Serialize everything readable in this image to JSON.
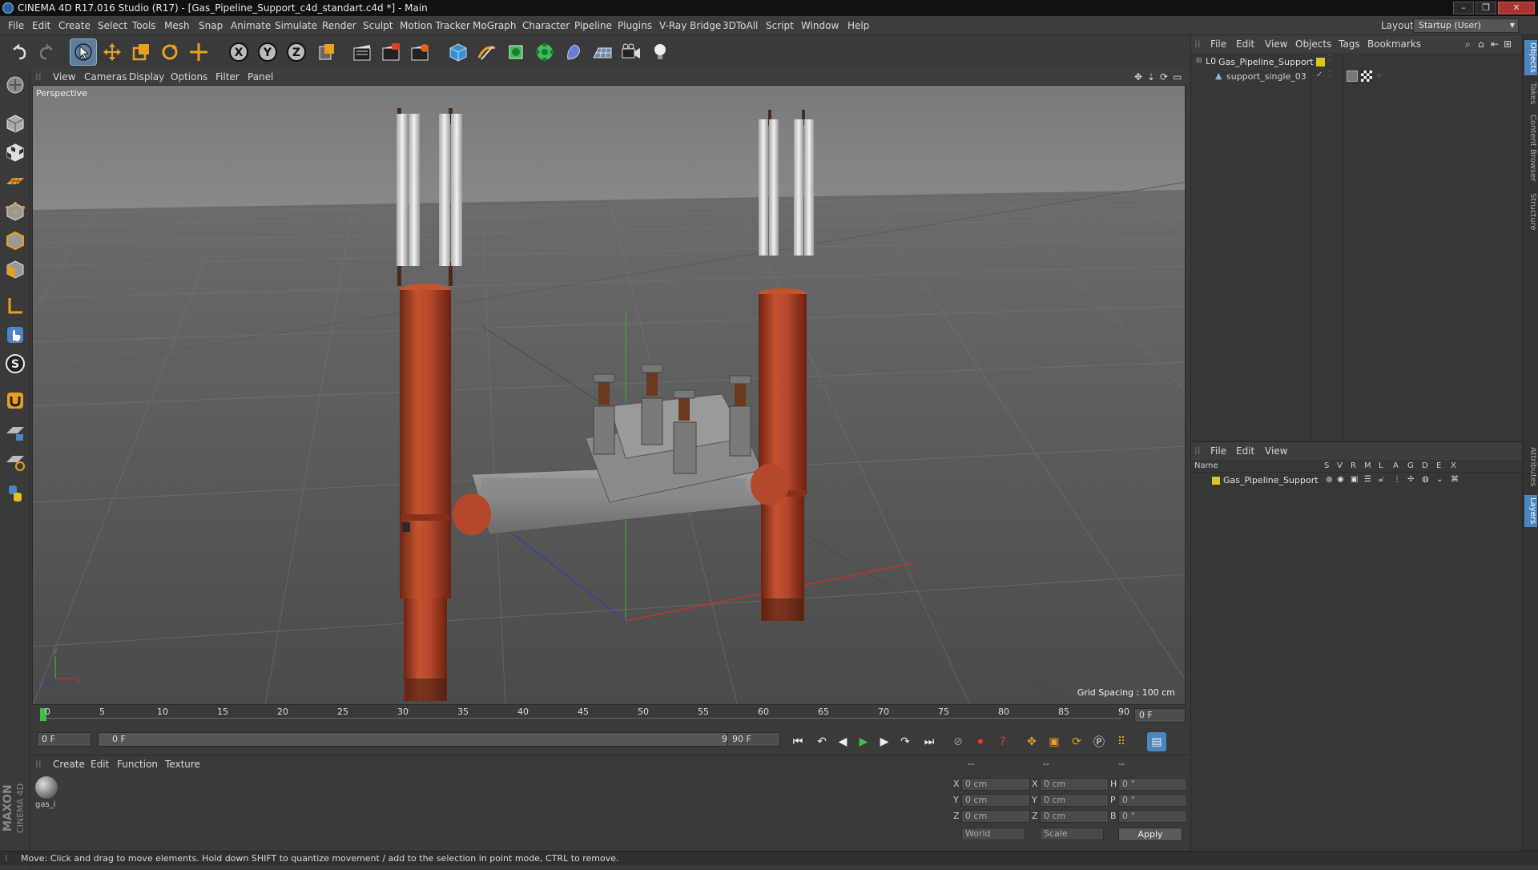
{
  "window": {
    "title": "CINEMA 4D R17.016 Studio (R17) - [Gas_Pipeline_Support_c4d_standart.c4d *] - Main",
    "controls": {
      "minimize": "–",
      "maximize": "❐",
      "close": "✕"
    }
  },
  "menubar": {
    "items": [
      "File",
      "Edit",
      "Create",
      "Select",
      "Tools",
      "Mesh",
      "Snap",
      "Animate",
      "Simulate",
      "Render",
      "Sculpt",
      "Motion Tracker",
      "MoGraph",
      "Character",
      "Pipeline",
      "Plugins",
      "V-Ray Bridge",
      "3DToAll",
      "Script",
      "Window",
      "Help"
    ],
    "layout_label": "Layout:",
    "layout_value": "Startup (User)"
  },
  "toolbar": {
    "axis_labels": [
      "X",
      "Y",
      "Z"
    ]
  },
  "viewport": {
    "menu": [
      "View",
      "Cameras",
      "Display",
      "Options",
      "Filter",
      "Panel"
    ],
    "label": "Perspective",
    "grid_spacing": "Grid Spacing : 100 cm",
    "axis_gizmo": {
      "x": "x",
      "y": "y",
      "z": "z"
    }
  },
  "timeline": {
    "ticks": [
      "0",
      "5",
      "10",
      "15",
      "20",
      "25",
      "30",
      "35",
      "40",
      "45",
      "50",
      "55",
      "60",
      "65",
      "70",
      "75",
      "80",
      "85",
      "90"
    ],
    "current_frame_right": "0 F"
  },
  "transport": {
    "start_field": "0 F",
    "range_start": "0 F",
    "range_end": "90 F",
    "end_field": "90 F"
  },
  "material_manager": {
    "menu": [
      "Create",
      "Edit",
      "Function",
      "Texture"
    ],
    "material_name": "gas_i"
  },
  "coordinates": {
    "headers": [
      "--",
      "--",
      "--"
    ],
    "rows": [
      {
        "l1": "X",
        "v1": "0 cm",
        "l2": "X",
        "v2": "0 cm",
        "l3": "H",
        "v3": "0 °"
      },
      {
        "l1": "Y",
        "v1": "0 cm",
        "l2": "Y",
        "v2": "0 cm",
        "l3": "P",
        "v3": "0 °"
      },
      {
        "l1": "Z",
        "v1": "0 cm",
        "l2": "Z",
        "v2": "0 cm",
        "l3": "B",
        "v3": "0 °"
      }
    ],
    "world": "World",
    "scale": "Scale",
    "apply": "Apply"
  },
  "object_manager": {
    "menu": [
      "File",
      "Edit",
      "View",
      "Objects",
      "Tags",
      "Bookmarks"
    ],
    "objects": [
      "Gas_Pipeline_Support",
      "support_single_03"
    ]
  },
  "layer_manager": {
    "menu": [
      "File",
      "Edit",
      "View"
    ],
    "columns": [
      "Name",
      "S",
      "V",
      "R",
      "M",
      "L",
      "A",
      "G",
      "D",
      "E",
      "X"
    ],
    "layers": [
      "Gas_Pipeline_Support"
    ]
  },
  "right_tabs": [
    "Objects",
    "Takes",
    "Content Browser",
    "Structure",
    "Attributes",
    "Layers"
  ],
  "brand": {
    "line1": "MAXON",
    "line2": "CINEMA 4D"
  },
  "statusbar": {
    "text": "Move: Click and drag to move elements. Hold down SHIFT to quantize movement / add to the selection in point mode, CTRL to remove."
  },
  "colors": {
    "pipe": "#b5472a",
    "layer_yellow": "#d8c81e",
    "accent_blue": "#5f7e9e"
  }
}
